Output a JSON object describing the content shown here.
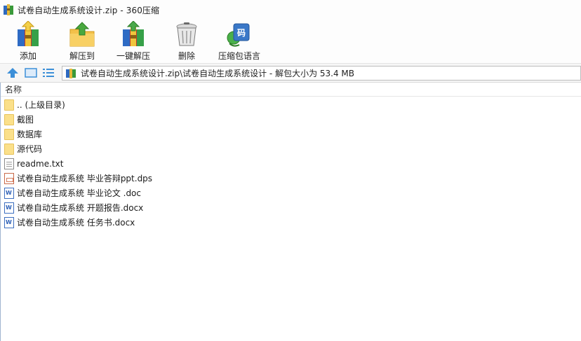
{
  "window": {
    "title": "试卷自动生成系统设计.zip - 360压缩"
  },
  "toolbar": {
    "buttons": [
      {
        "label": "添加",
        "icon": "add-archive-icon"
      },
      {
        "label": "解压到",
        "icon": "extract-to-icon"
      },
      {
        "label": "一键解压",
        "icon": "one-click-extract-icon"
      },
      {
        "label": "删除",
        "icon": "trash-icon"
      },
      {
        "label": "压缩包语言",
        "icon": "archive-language-icon"
      }
    ]
  },
  "addressbar": {
    "path": "试卷自动生成系统设计.zip\\试卷自动生成系统设计 - 解包大小为 53.4 MB"
  },
  "filelist": {
    "header": "名称",
    "items": [
      {
        "name": ".. (上级目录)",
        "icon": "folder-icon"
      },
      {
        "name": "截图",
        "icon": "folder-icon"
      },
      {
        "name": "数据库",
        "icon": "folder-icon"
      },
      {
        "name": "源代码",
        "icon": "folder-icon"
      },
      {
        "name": "readme.txt",
        "icon": "text-file-icon"
      },
      {
        "name": "试卷自动生成系统 毕业答辩ppt.dps",
        "icon": "dps-file-icon"
      },
      {
        "name": "试卷自动生成系统 毕业论文 .doc",
        "icon": "word-file-icon"
      },
      {
        "name": "试卷自动生成系统 开题报告.docx",
        "icon": "word-file-icon"
      },
      {
        "name": "试卷自动生成系统 任务书.docx",
        "icon": "word-file-icon"
      }
    ]
  },
  "colors": {
    "accent_blue": "#3c8fd8",
    "folder_yellow": "#fbe08a",
    "list_border": "#a0b4d0"
  }
}
